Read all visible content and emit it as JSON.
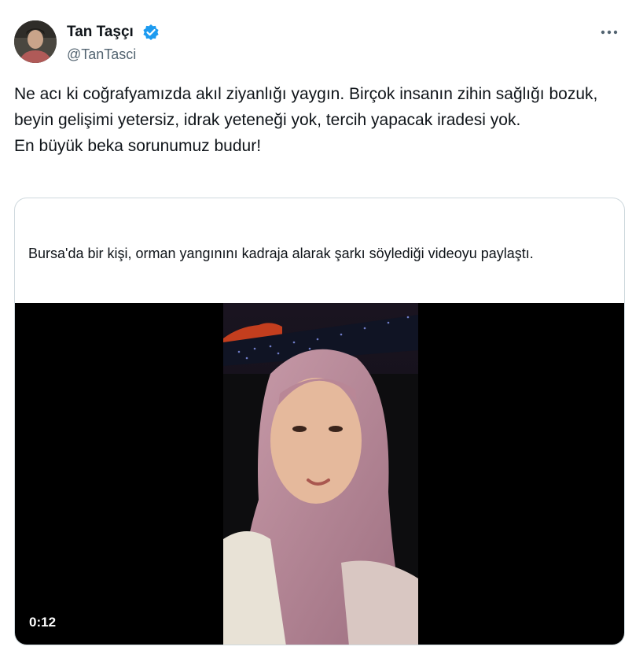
{
  "author": {
    "name": "Tan Taşçı",
    "handle": "@TanTasci",
    "verified": true
  },
  "tweet": {
    "paragraphs": [
      "Ne acı ki coğrafyamızda akıl ziyanlığı yaygın. Birçok insanın zihin sağlığı bozuk, beyin gelişimi yetersiz, idrak yeteneği yok, tercih yapacak iradesi yok.",
      "En büyük beka sorunumuz budur!"
    ]
  },
  "quoted_card": {
    "caption": "Bursa'da bir kişi, orman yangınını kadraja alarak şarkı söylediği videoyu paylaştı.",
    "video": {
      "duration": "0:12"
    }
  },
  "icons": {
    "more": "more-horizontal-icon",
    "verified": "verified-badge-icon"
  },
  "colors": {
    "verified_blue": "#1d9bf0",
    "secondary_text": "#536471",
    "border": "#cfd9de"
  }
}
